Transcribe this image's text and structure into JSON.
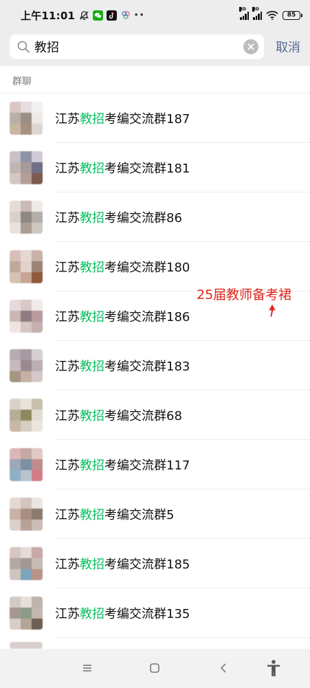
{
  "status_bar": {
    "time": "上午11:01",
    "battery": "85",
    "icons": [
      "bell-muted-icon",
      "wechat-icon",
      "tiktok-icon",
      "cloud-icon",
      "more-dots-icon",
      "signal-hd-icon",
      "signal-hd-icon",
      "wifi-icon",
      "battery-icon"
    ]
  },
  "search": {
    "query": "教招",
    "cancel_label": "取消",
    "icon": "search-icon"
  },
  "results": {
    "section_title": "群聊",
    "items": [
      {
        "prefix": "江苏",
        "highlight": "教招",
        "suffix": "考编交流群187",
        "avatar": [
          "#d9c6c0",
          "#e6dede",
          "#f3f0f0",
          "#b8b0a8",
          "#9a8f86",
          "#eee8e6",
          "#c8b7a0",
          "#a89080",
          "#ddd6cf"
        ]
      },
      {
        "prefix": "江苏",
        "highlight": "教招",
        "suffix": "考编交流群181",
        "avatar": [
          "#c9c0c8",
          "#8f93a6",
          "#d0cbd6",
          "#bfb6b1",
          "#a79a98",
          "#6f6e86",
          "#d6c7c3",
          "#b49e95",
          "#7d5a4e"
        ]
      },
      {
        "prefix": "江苏",
        "highlight": "教招",
        "suffix": "考编交流群86",
        "avatar": [
          "#e4dcd8",
          "#cbbab3",
          "#efeae6",
          "#d9d0cb",
          "#8c8880",
          "#b4aea8",
          "#e8e2de",
          "#a89e94",
          "#d0c8c2"
        ]
      },
      {
        "prefix": "江苏",
        "highlight": "教招",
        "suffix": "考编交流群180",
        "avatar": [
          "#d7c0b8",
          "#e8d8d2",
          "#c9b2a6",
          "#bfa99c",
          "#e1d2cb",
          "#9e8378",
          "#d6c2b7",
          "#c8a592",
          "#8e5a3c"
        ]
      },
      {
        "prefix": "江苏",
        "highlight": "教招",
        "suffix": "考编交流群186",
        "avatar": [
          "#e6dada",
          "#d8c8c8",
          "#f1eaea",
          "#cbb6b6",
          "#8f7c80",
          "#b89a9c",
          "#eee4e2",
          "#d8c6c2",
          "#c4b0ae"
        ]
      },
      {
        "prefix": "江苏",
        "highlight": "教招",
        "suffix": "考编交流群183",
        "avatar": [
          "#b8aab0",
          "#a89aa4",
          "#d8cfd4",
          "#c7b9bd",
          "#9c8890",
          "#bcaeb4",
          "#a49680",
          "#c6b0a4",
          "#d4c8c8"
        ]
      },
      {
        "prefix": "江苏",
        "highlight": "教招",
        "suffix": "考编交流群68",
        "avatar": [
          "#d8d2c6",
          "#e8e4dc",
          "#c8c0ae",
          "#b8ae98",
          "#8e8a60",
          "#e2ddd2",
          "#c6b8a4",
          "#d6cec0",
          "#eae6de"
        ]
      },
      {
        "prefix": "江苏",
        "highlight": "教招",
        "suffix": "考编交流群117",
        "avatar": [
          "#dcb8b4",
          "#c6a8a6",
          "#e2c8c6",
          "#9ca8b8",
          "#7f8fa4",
          "#c08c8c",
          "#8fb0c8",
          "#b8c4cc",
          "#d47c86"
        ]
      },
      {
        "prefix": "江苏",
        "highlight": "教招",
        "suffix": "考编交流群5",
        "avatar": [
          "#e2d8d4",
          "#d4c4be",
          "#ece6e2",
          "#c8b2a8",
          "#a88e80",
          "#8c7a6e",
          "#dcd0ca",
          "#b8a196",
          "#cbbcb4"
        ]
      },
      {
        "prefix": "江苏",
        "highlight": "教招",
        "suffix": "考编交流群185",
        "avatar": [
          "#d8c6c2",
          "#e6dada",
          "#c8a8a8",
          "#b4a8a6",
          "#a49896",
          "#c6bcb6",
          "#d0c4be",
          "#7ea4bc",
          "#b89488"
        ]
      },
      {
        "prefix": "江苏",
        "highlight": "教招",
        "suffix": "考编交流群135",
        "avatar": [
          "#d2cac6",
          "#e6e0dc",
          "#bdb2ac",
          "#a69890",
          "#8c9a88",
          "#c4b8b0",
          "#d8cec8",
          "#b4a498",
          "#6e5e54"
        ]
      }
    ]
  },
  "annotation": {
    "text": "25届教师备考裙",
    "color": "#e0251b"
  },
  "nav": {
    "icons": [
      "menu-icon",
      "home-square-icon",
      "back-icon",
      "accessibility-icon"
    ]
  },
  "colors": {
    "highlight": "#07c160",
    "link": "#576b95",
    "background": "#ededed"
  }
}
